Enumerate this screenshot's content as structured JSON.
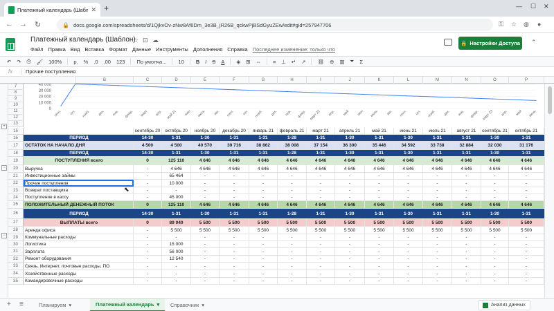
{
  "browser": {
    "tab_title": "Платежный календарь (Шаблон",
    "url": "docs.google.com/spreadsheets/d/1QjkvOv-zNw8Af6Dm_3e3B_jR26B_qckwPjBSdGyuZEw/edit#gid=257947706"
  },
  "doc": {
    "title": "Платежный календарь (Шаблон)",
    "menu": [
      "Файл",
      "Правка",
      "Вид",
      "Вставка",
      "Формат",
      "Данные",
      "Инструменты",
      "Дополнения",
      "Справка"
    ],
    "last_edit": "Последнее изменение: только что",
    "share_label": "Настройки Доступа"
  },
  "toolbar": {
    "zoom": "100%",
    "currency": "р.",
    "percent": "%",
    "dec0": ".0",
    "dec00": ".00",
    "format123": "123",
    "font": "По умолча...",
    "size": "10",
    "bold": "B",
    "italic": "I",
    "strike": "S",
    "color": "A"
  },
  "formula": {
    "fx": "fx",
    "value": "Прочие поступления"
  },
  "columns": [
    "",
    "B",
    "C",
    "D",
    "E",
    "F",
    "G",
    "H",
    "I",
    "J",
    "K",
    "L",
    "M",
    "N",
    "O",
    "P"
  ],
  "chart_data": {
    "type": "line",
    "yticks": [
      "40 000",
      "30 000",
      "20 000",
      "10 000",
      "0"
    ],
    "x": [
      "сент.",
      "окт.",
      "нояб.",
      "дек.",
      "янв.",
      "февр.",
      "март",
      "апр.",
      "май 21",
      "июн",
      "июль",
      "авг.",
      "сент.",
      "окт.",
      "нояб.",
      "дек.",
      "янв.",
      "февр.",
      "март 22",
      "апр.",
      "май",
      "июн",
      "июль",
      "авг.",
      "сент.",
      "окт.",
      "нояб.",
      "дек.",
      "янв.",
      "февр.",
      "март 23",
      "апр.",
      "май",
      "июнь"
    ],
    "series": [
      {
        "values": [
          4500,
          40570,
          39716,
          38862,
          38008,
          37154,
          36300,
          35446,
          34592,
          33738,
          32884,
          32030,
          31176,
          30322,
          29468,
          28614,
          27760,
          26906,
          26052,
          25198,
          24344,
          23490,
          22636,
          21782,
          20928,
          20074,
          19220,
          18366,
          17512,
          16658,
          15804,
          14950,
          14096,
          13242
        ]
      }
    ],
    "ylim": [
      0,
      40000
    ]
  },
  "row_numbers": {
    "chart": [
      "7",
      "8",
      "9",
      "10",
      "11",
      "12",
      "13"
    ],
    "table": [
      "15",
      "16",
      "17",
      "18",
      "19",
      "20",
      "21",
      "22",
      "23",
      "24",
      "25",
      "26",
      "27",
      "28",
      "29",
      "30",
      "31",
      "32",
      "33",
      "34",
      "35",
      "36"
    ]
  },
  "table": {
    "months": [
      "",
      "",
      "сентябрь 20",
      "октябрь 20",
      "ноябрь 20",
      "декабрь 20",
      "январь 21",
      "февраль 21",
      "март 21",
      "апрель 21",
      "май 21",
      "июнь 21",
      "июль 21",
      "август 21",
      "сентябрь 21",
      "октябрь 21"
    ],
    "rows": [
      {
        "style": "blue",
        "label": "ПЕРИОД",
        "center": true,
        "cells": [
          "14-30",
          "1-31",
          "1-30",
          "1-31",
          "1-31",
          "1-28",
          "1-31",
          "1-30",
          "1-31",
          "1-30",
          "1-31",
          "1-31",
          "1-30",
          "1-31"
        ]
      },
      {
        "style": "grey",
        "label": "ОСТАТОК НА НАЧАЛО ДНЯ",
        "cells": [
          "4 500",
          "4 500",
          "40 570",
          "39 716",
          "38 862",
          "38 008",
          "37 154",
          "36 300",
          "35 446",
          "34 592",
          "33 738",
          "32 884",
          "32 030",
          "31 176"
        ]
      },
      {
        "style": "blue",
        "label": "ПЕРИОД",
        "center": true,
        "cells": [
          "14-30",
          "1-31",
          "1-30",
          "1-31",
          "1-31",
          "1-28",
          "1-31",
          "1-30",
          "1-31",
          "1-30",
          "1-31",
          "1-31",
          "1-30",
          "1-31"
        ]
      },
      {
        "style": "green",
        "label": "ПОСТУПЛЕНИЯ всего",
        "center": true,
        "cells": [
          "0",
          "125 110",
          "4 646",
          "4 646",
          "4 646",
          "4 646",
          "4 646",
          "4 646",
          "4 646",
          "4 646",
          "4 646",
          "4 646",
          "4 646",
          "4 646"
        ]
      },
      {
        "style": "",
        "label": "Выручка",
        "cells": [
          "-",
          "4 646",
          "4 646",
          "4 646",
          "4 646",
          "4 646",
          "4 646",
          "4 646",
          "4 646",
          "4 646",
          "4 646",
          "4 646",
          "4 646",
          "4 646"
        ]
      },
      {
        "style": "",
        "label": "Инвестиционные займы",
        "cells": [
          "-",
          "65 464",
          "-",
          "-",
          "-",
          "-",
          "-",
          "-",
          "-",
          "-",
          "-",
          "-",
          "-",
          "-"
        ]
      },
      {
        "style": "sel",
        "label": "Прочие поступления",
        "cells": [
          "-",
          "10 000",
          "-",
          "-",
          "-",
          "-",
          "-",
          "-",
          "-",
          "-",
          "-",
          "-",
          "-",
          "-"
        ]
      },
      {
        "style": "",
        "label": "Возврат поставщика",
        "cells": [
          "-",
          "-",
          "-",
          "-",
          "-",
          "-",
          "-",
          "-",
          "-",
          "-",
          "-",
          "-",
          "-",
          "-"
        ]
      },
      {
        "style": "",
        "label": "Поступление в кассу",
        "cells": [
          "-",
          "45 000",
          "-",
          "-",
          "-",
          "-",
          "-",
          "-",
          "-",
          "-",
          "-",
          "-",
          "-",
          "-"
        ]
      },
      {
        "style": "green2",
        "label": "ПОЛОЖИТЕЛЬНЫЙ ДЕНЕЖНЫЙ ПОТОК",
        "cells": [
          "0",
          "125 110",
          "4 646",
          "4 646",
          "4 646",
          "4 646",
          "4 646",
          "4 646",
          "4 646",
          "4 646",
          "4 646",
          "4 646",
          "4 646",
          "4 646"
        ]
      },
      {
        "style": "blue",
        "label": "ПЕРИОД",
        "center": true,
        "cells": [
          "14-30",
          "1-31",
          "1-30",
          "1-31",
          "1-31",
          "1-28",
          "1-31",
          "1-30",
          "1-31",
          "1-30",
          "1-31",
          "1-31",
          "1-30",
          "1-31"
        ]
      },
      {
        "style": "pink",
        "label": "ВЫПЛАТЫ всего",
        "center": true,
        "cells": [
          "0",
          "89 040",
          "5 500",
          "5 500",
          "5 500",
          "5 500",
          "5 500",
          "5 500",
          "5 500",
          "5 500",
          "5 500",
          "5 500",
          "5 500",
          "5 500"
        ]
      },
      {
        "style": "",
        "label": "Аренда офиса",
        "cells": [
          "-",
          "5 500",
          "5 500",
          "5 500",
          "5 500",
          "5 500",
          "5 500",
          "5 500",
          "5 500",
          "5 500",
          "5 500",
          "5 500",
          "5 500",
          "5 500"
        ]
      },
      {
        "style": "",
        "label": "Коммунальные расходы",
        "cells": [
          "-",
          "-",
          "-",
          "-",
          "-",
          "-",
          "-",
          "-",
          "-",
          "-",
          "-",
          "-",
          "-",
          "-"
        ]
      },
      {
        "style": "",
        "label": "Логистика",
        "cells": [
          "-",
          "15 000",
          "-",
          "-",
          "-",
          "-",
          "-",
          "-",
          "-",
          "-",
          "-",
          "-",
          "-",
          "-"
        ]
      },
      {
        "style": "",
        "label": "Зарплата",
        "cells": [
          "-",
          "56 000",
          "-",
          "-",
          "-",
          "-",
          "-",
          "-",
          "-",
          "-",
          "-",
          "-",
          "-",
          "-"
        ]
      },
      {
        "style": "",
        "label": "Ремонт оборудования",
        "cells": [
          "-",
          "12 540",
          "-",
          "-",
          "-",
          "-",
          "-",
          "-",
          "-",
          "-",
          "-",
          "-",
          "-",
          "-"
        ]
      },
      {
        "style": "",
        "label": "Связь, Интернет, почтовые расходы, ПО",
        "cells": [
          "-",
          "-",
          "-",
          "-",
          "-",
          "-",
          "-",
          "-",
          "-",
          "-",
          "-",
          "-",
          "-",
          "-"
        ]
      },
      {
        "style": "",
        "label": "Хозяйственные расходы",
        "cells": [
          "-",
          "-",
          "-",
          "-",
          "-",
          "-",
          "-",
          "-",
          "-",
          "-",
          "-",
          "-",
          "-",
          "-"
        ]
      },
      {
        "style": "",
        "label": "Командировочные расходы",
        "cells": [
          "-",
          "-",
          "-",
          "-",
          "-",
          "-",
          "-",
          "-",
          "-",
          "-",
          "-",
          "-",
          "-",
          "-"
        ]
      }
    ]
  },
  "sheets": {
    "tabs": [
      "Планируем",
      "Платежный календарь",
      "Справочник"
    ],
    "active": 1,
    "explore_label": "Анализ данных"
  },
  "colors": {
    "accent": "#188038",
    "header_blue": "#1c4587"
  }
}
